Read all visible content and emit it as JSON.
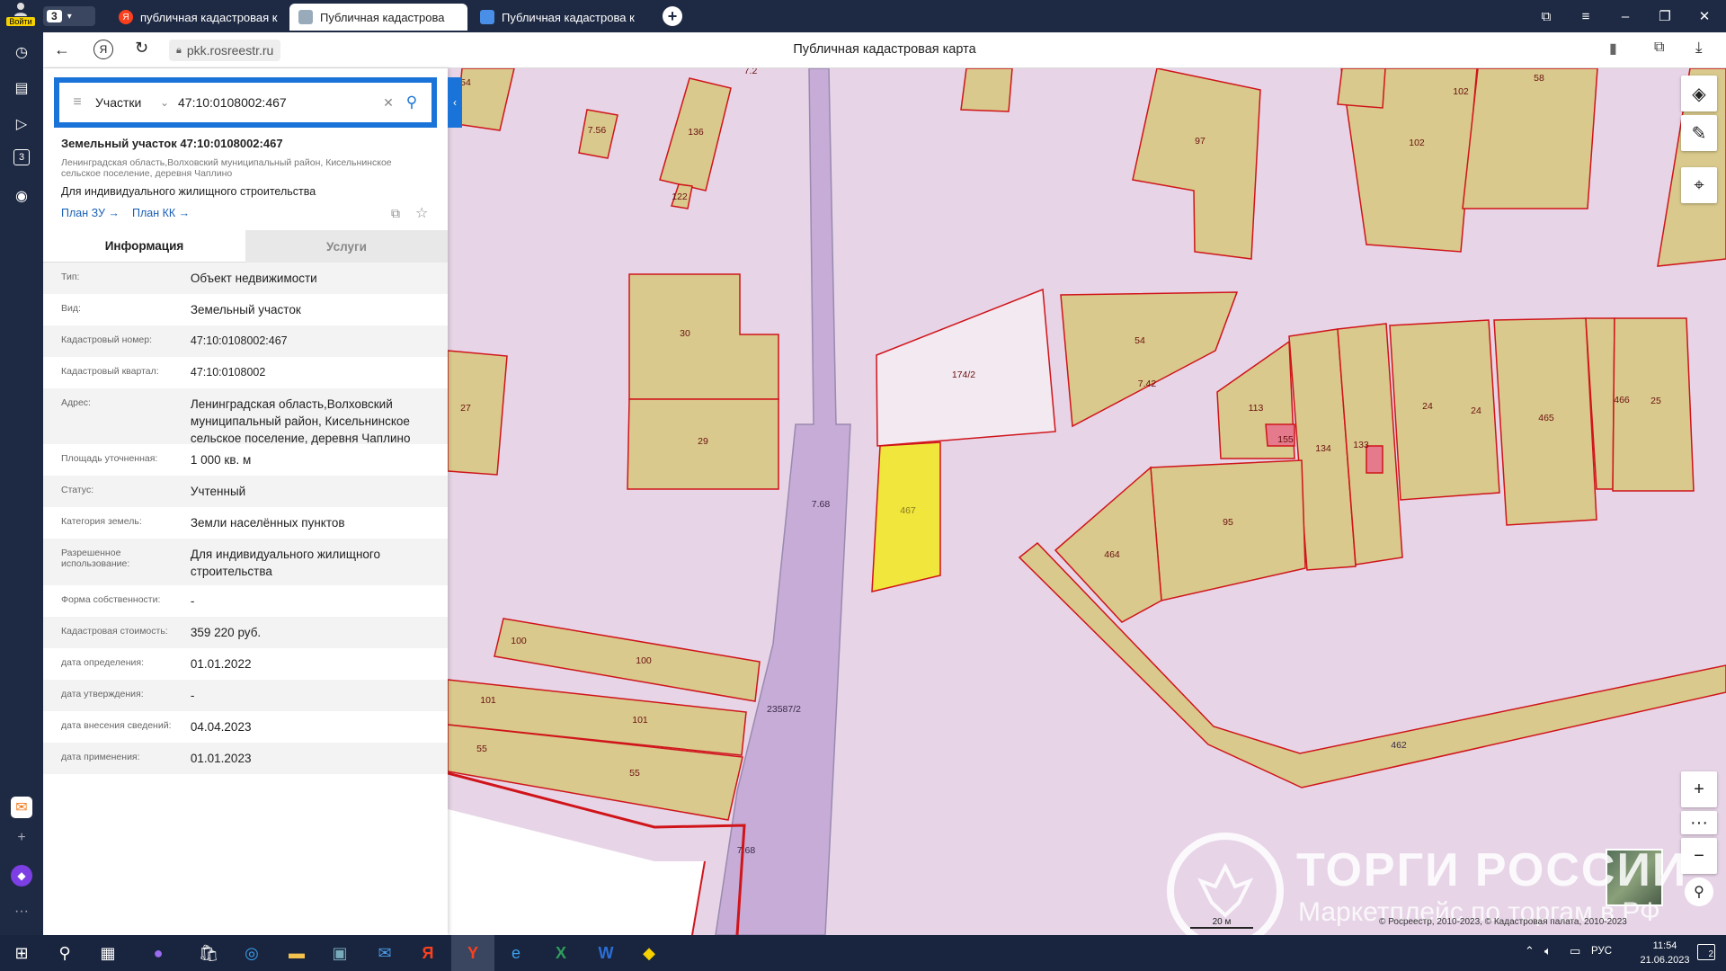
{
  "browser": {
    "login_label": "Войти",
    "tab_count": "3",
    "tabs": [
      {
        "label": "публичная кадастровая к",
        "active": false
      },
      {
        "label": "Публичная кадастрова",
        "active": true
      },
      {
        "label": "Публичная кадастрова к",
        "active": false
      }
    ],
    "url": "pkk.rosreestr.ru",
    "page_title": "Публичная кадастровая карта"
  },
  "search": {
    "category": "Участки",
    "query": "47:10:0108002:467"
  },
  "object": {
    "title": "Земельный участок 47:10:0108002:467",
    "address_short": "Ленинградская область,Волховский муниципальный район, Кисельнинское сельское поселение, деревня Чаплино",
    "purpose": "Для индивидуального жилищного строительства",
    "plan_zu": "План ЗУ →",
    "plan_kk": "План КК →"
  },
  "tabs": {
    "info": "Информация",
    "services": "Услуги"
  },
  "info_rows": [
    {
      "key": "Тип:",
      "value": "Объект недвижимости"
    },
    {
      "key": "Вид:",
      "value": "Земельный участок"
    },
    {
      "key": "Кадастровый номер:",
      "value": "47:10:0108002:467"
    },
    {
      "key": "Кадастровый квартал:",
      "value": "47:10:0108002"
    },
    {
      "key": "Адрес:",
      "value": "Ленинградская область,Волховский муниципальный район, Кисельнинское сельское поселение, деревня Чаплино"
    },
    {
      "key": "Площадь уточненная:",
      "value": "1 000 кв. м"
    },
    {
      "key": "Статус:",
      "value": "Учтенный"
    },
    {
      "key": "Категория земель:",
      "value": "Земли населённых пунктов"
    },
    {
      "key": "Разрешенное использование:",
      "value": "Для индивидуального жилищного строительства"
    },
    {
      "key": "Форма собственности:",
      "value": "-"
    },
    {
      "key": "Кадастровая стоимость:",
      "value": "359 220 руб."
    },
    {
      "key": "дата определения:",
      "value": "01.01.2022"
    },
    {
      "key": "дата утверждения:",
      "value": "-"
    },
    {
      "key": "дата внесения сведений:",
      "value": "04.04.2023"
    },
    {
      "key": "дата применения:",
      "value": "01.01.2023"
    }
  ],
  "map": {
    "parcel_labels": [
      "54",
      "7.2",
      "7.56",
      "136",
      "122",
      "97",
      "102",
      "102",
      "58",
      "30",
      "174/2",
      "54",
      "7.42",
      "27",
      "29",
      "113",
      "155",
      "134",
      "133",
      "24",
      "24",
      "465",
      "466",
      "25",
      "467",
      "7.68",
      "95",
      "464",
      "100",
      "100",
      "101",
      "101",
      "55",
      "55",
      "23587/2",
      "7.68",
      "462"
    ],
    "scale": "20 м",
    "attribution": "© Росреестр, 2010-2023, © Кадастровая палата, 2010-2023",
    "watermark_title": "ТОРГИ РОССИИ",
    "watermark_subtitle": "Маркетплейс по торгам в РФ",
    "colors": {
      "parcel_fill": "#d9c98c",
      "parcel_stroke": "#d0141a",
      "selected_fill": "#f0e63c",
      "background": "#e7d5e7",
      "road": "#c6acd6"
    }
  },
  "taskbar": {
    "lang": "РУС",
    "time": "11:54",
    "date": "21.06.2023",
    "notifications": "2"
  }
}
